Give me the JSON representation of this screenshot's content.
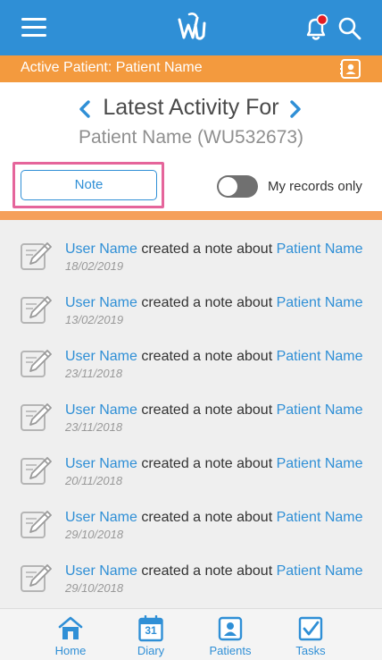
{
  "header": {
    "menu_icon": "hamburger-menu-icon",
    "logo_icon": "wu-logo-icon",
    "bell_icon": "notification-bell-icon",
    "search_icon": "search-icon"
  },
  "patient_bar": {
    "label": "Active Patient: Patient Name",
    "contact_icon": "contact-card-icon"
  },
  "activity_header": {
    "title": "Latest Activity For",
    "patient": "Patient Name (WU532673)",
    "prev_icon": "chevron-left-icon",
    "next_icon": "chevron-right-icon"
  },
  "filters": {
    "note_button": "Note",
    "my_records_label": "My records only",
    "my_records_on": false
  },
  "activities": [
    {
      "user": "User Name",
      "action": " created a note about ",
      "patient": "Patient Name",
      "date": "18/02/2019"
    },
    {
      "user": "User Name",
      "action": " created a note about ",
      "patient": "Patient Name",
      "date": "13/02/2019"
    },
    {
      "user": "User Name",
      "action": " created a note about ",
      "patient": "Patient Name",
      "date": "23/11/2018"
    },
    {
      "user": "User Name",
      "action": " created a note about ",
      "patient": "Patient Name",
      "date": "23/11/2018"
    },
    {
      "user": "User Name",
      "action": " created a note about ",
      "patient": "Patient Name",
      "date": "20/11/2018"
    },
    {
      "user": "User Name",
      "action": " created a note about ",
      "patient": "Patient Name",
      "date": "29/10/2018"
    },
    {
      "user": "User Name",
      "action": " created a note about ",
      "patient": "Patient Name",
      "date": "29/10/2018"
    }
  ],
  "nav": [
    {
      "label": "Home",
      "icon": "home-icon"
    },
    {
      "label": "Diary",
      "icon": "calendar-icon",
      "badge": "31"
    },
    {
      "label": "Patients",
      "icon": "patient-card-icon"
    },
    {
      "label": "Tasks",
      "icon": "checkbox-icon"
    }
  ],
  "colors": {
    "primary": "#2f8fd6",
    "accent": "#f39a3e",
    "highlight": "#e5659b",
    "notification_dot": "#e31c24"
  }
}
